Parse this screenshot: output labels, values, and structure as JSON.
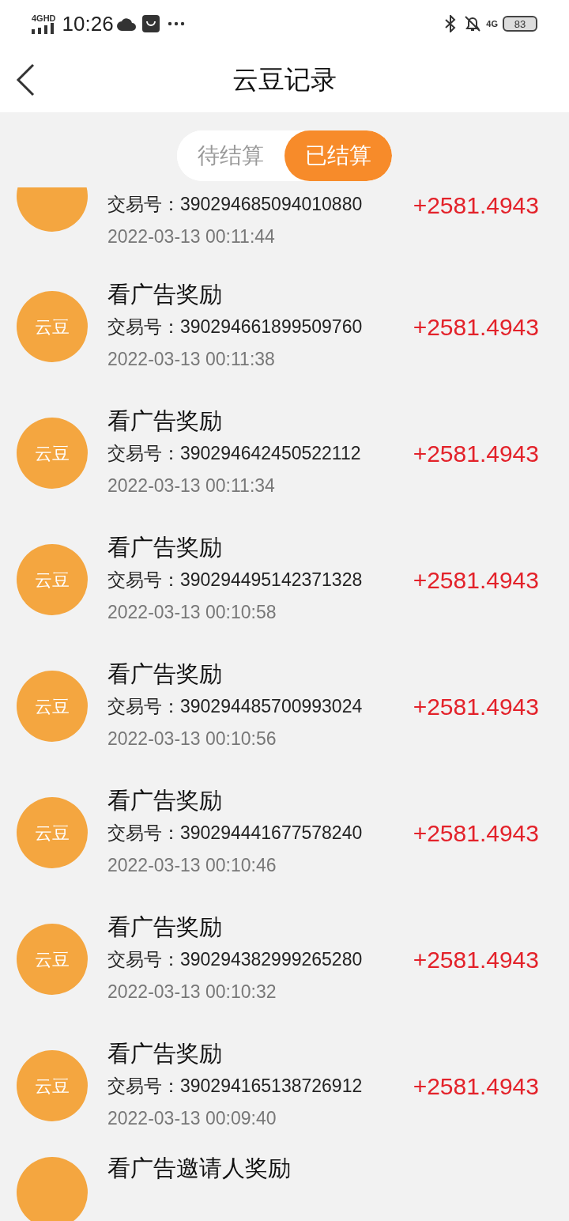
{
  "status_bar": {
    "network": "4GHD",
    "time": "10:26",
    "mobile": "4G",
    "battery": "83"
  },
  "header": {
    "title": "云豆记录"
  },
  "tabs": [
    {
      "label": "待结算",
      "selected": false
    },
    {
      "label": "已结算",
      "selected": true
    }
  ],
  "records": [
    {
      "tx_label": "交易号：",
      "tx": "390294685094010880",
      "time": "2022-03-13 00:11:44",
      "amount": "+2581.4943"
    },
    {
      "avatar": "云豆",
      "title": "看广告奖励",
      "tx_label": "交易号：",
      "tx": "390294661899509760",
      "time": "2022-03-13 00:11:38",
      "amount": "+2581.4943"
    },
    {
      "avatar": "云豆",
      "title": "看广告奖励",
      "tx_label": "交易号：",
      "tx": "390294642450522112",
      "time": "2022-03-13 00:11:34",
      "amount": "+2581.4943"
    },
    {
      "avatar": "云豆",
      "title": "看广告奖励",
      "tx_label": "交易号：",
      "tx": "390294495142371328",
      "time": "2022-03-13 00:10:58",
      "amount": "+2581.4943"
    },
    {
      "avatar": "云豆",
      "title": "看广告奖励",
      "tx_label": "交易号：",
      "tx": "390294485700993024",
      "time": "2022-03-13 00:10:56",
      "amount": "+2581.4943"
    },
    {
      "avatar": "云豆",
      "title": "看广告奖励",
      "tx_label": "交易号：",
      "tx": "390294441677578240",
      "time": "2022-03-13 00:10:46",
      "amount": "+2581.4943"
    },
    {
      "avatar": "云豆",
      "title": "看广告奖励",
      "tx_label": "交易号：",
      "tx": "390294382999265280",
      "time": "2022-03-13 00:10:32",
      "amount": "+2581.4943"
    },
    {
      "avatar": "云豆",
      "title": "看广告奖励",
      "tx_label": "交易号：",
      "tx": "390294165138726912",
      "time": "2022-03-13 00:09:40",
      "amount": "+2581.4943"
    },
    {
      "title": "看广告邀请人奖励"
    }
  ]
}
